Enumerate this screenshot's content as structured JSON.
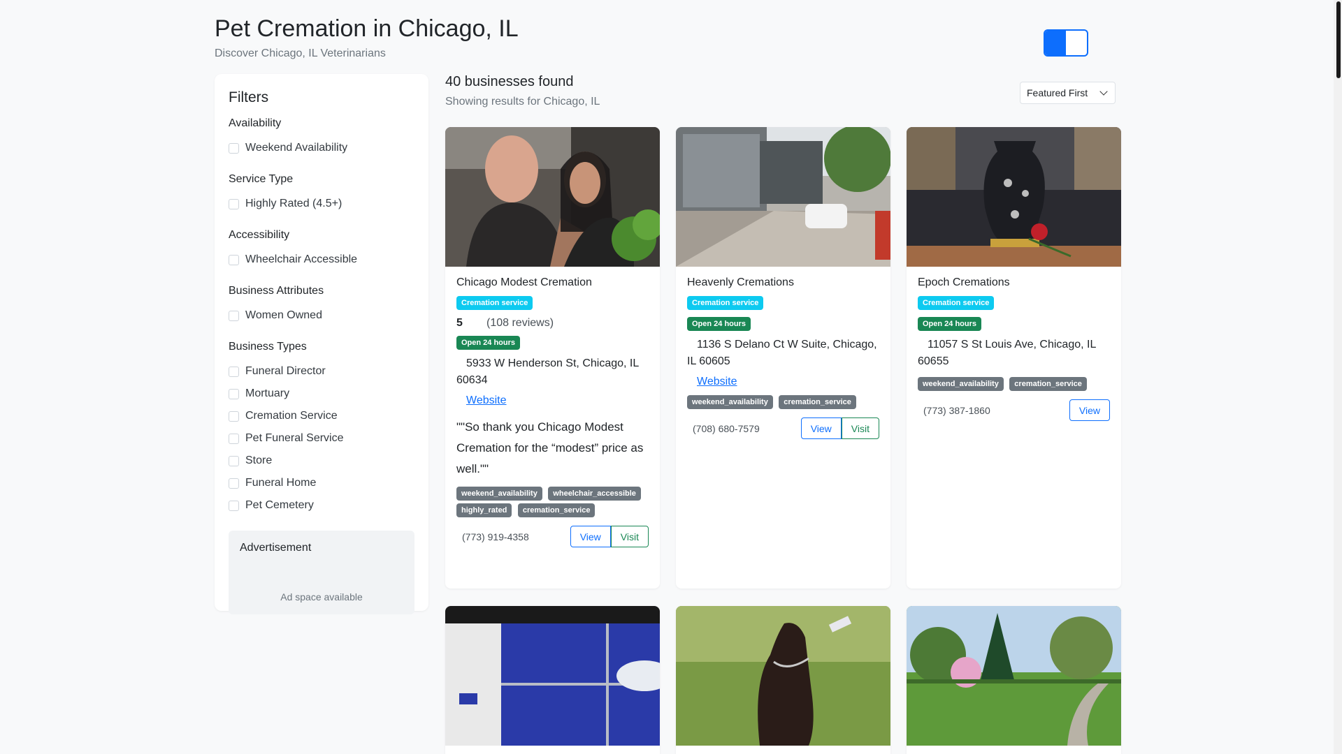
{
  "header": {
    "title": "Pet Cremation in Chicago, IL",
    "subtitle": "Discover Chicago, IL Veterinarians"
  },
  "theme_toggle": {
    "state": "half",
    "accent": "#0d6efd"
  },
  "filters": {
    "heading": "Filters",
    "groups": [
      {
        "title": "Availability",
        "options": [
          "Weekend Availability"
        ]
      },
      {
        "title": "Service Type",
        "options": [
          "Highly Rated (4.5+)"
        ]
      },
      {
        "title": "Accessibility",
        "options": [
          "Wheelchair Accessible"
        ]
      },
      {
        "title": "Business Attributes",
        "options": [
          "Women Owned"
        ]
      },
      {
        "title": "Business Types",
        "options": [
          "Funeral Director",
          "Mortuary",
          "Cremation Service",
          "Pet Funeral Service",
          "Store",
          "Funeral Home",
          "Pet Cemetery"
        ]
      }
    ],
    "ad": {
      "title": "Advertisement",
      "text": "Ad space available"
    }
  },
  "results": {
    "count_label": "40 businesses found",
    "location_label": "Showing results for Chicago, IL",
    "sort": {
      "selected": "Featured First"
    }
  },
  "cards": [
    {
      "name": "Chicago Modest Cremation",
      "category": "Cremation service",
      "rating": "5",
      "reviews": "(108 reviews)",
      "hours": "Open 24 hours",
      "address": "5933 W Henderson St, Chicago, IL 60634",
      "website": "Website",
      "quote": "\"\"So thank you Chicago Modest Cremation for the “modest” price as well.\"\"",
      "tags": [
        "weekend_availability",
        "wheelchair_accessible",
        "highly_rated",
        "cremation_service"
      ],
      "phone": "(773) 919-4358",
      "view": "View",
      "visit": "Visit"
    },
    {
      "name": "Heavenly Cremations",
      "category": "Cremation service",
      "hours": "Open 24 hours",
      "address": "1136 S Delano Ct W Suite, Chicago, IL 60605",
      "website": "Website",
      "tags": [
        "weekend_availability",
        "cremation_service"
      ],
      "phone": "(708) 680-7579",
      "view": "View",
      "visit": "Visit"
    },
    {
      "name": "Epoch Cremations",
      "category": "Cremation service",
      "hours": "Open 24 hours",
      "address": "11057 S St Louis Ave, Chicago, IL 60655",
      "tags": [
        "weekend_availability",
        "cremation_service"
      ],
      "phone": "(773) 387-1860",
      "view": "View"
    }
  ],
  "colors": {
    "badge_category": "#0dcaf0",
    "badge_hours": "#198754",
    "badge_tag": "#6c757d",
    "link": "#0d6efd"
  }
}
